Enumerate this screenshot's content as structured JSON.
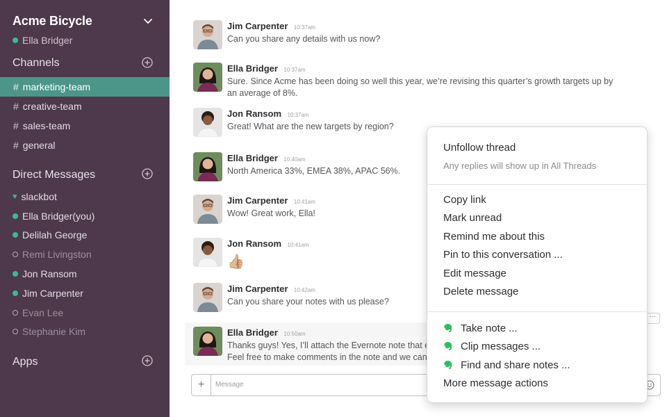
{
  "colors": {
    "sidebar_bg": "#4d394b",
    "active_channel": "#4c9689",
    "presence_online": "#3eb991",
    "evernote_green": "#2dbe60"
  },
  "team": {
    "name": "Acme Bicycle",
    "user": "Ella Bridger"
  },
  "sections": {
    "channels_title": "Channels",
    "direct_messages_title": "Direct Messages",
    "apps_title": "Apps"
  },
  "channels": [
    {
      "name": "marketing-team",
      "active": true
    },
    {
      "name": "creative-team",
      "active": false
    },
    {
      "name": "sales-team",
      "active": false
    },
    {
      "name": "general",
      "active": false
    }
  ],
  "direct_messages": [
    {
      "name": "slackbot",
      "status": "bot"
    },
    {
      "name": "Ella Bridger(you)",
      "status": "online"
    },
    {
      "name": "Delilah George",
      "status": "online"
    },
    {
      "name": "Remi Livingston",
      "status": "away"
    },
    {
      "name": "Jon Ransom",
      "status": "online"
    },
    {
      "name": "Jim Carpenter",
      "status": "online"
    },
    {
      "name": "Evan Lee",
      "status": "away"
    },
    {
      "name": "Stephanie Kim",
      "status": "away"
    }
  ],
  "messages": [
    {
      "author": "Jim Carpenter",
      "time": "10:37am",
      "text": "Can you share any details with us now?"
    },
    {
      "author": "Ella Bridger",
      "time": "10:37am",
      "text": "Sure. Since Acme has been doing so well this year, we’re revising this quarter’s growth targets up by an average of 8%."
    },
    {
      "author": "Jon Ransom",
      "time": "10:37am",
      "text": "Great! What are the new targets by region?"
    },
    {
      "author": "Ella Bridger",
      "time": "10:40am",
      "text": "North America 33%, EMEA 38%, APAC 56%."
    },
    {
      "author": "Jim Carpenter",
      "time": "10:41am",
      "text": "Wow! Great work, Ella!"
    },
    {
      "author": "Jon Ransom",
      "time": "10:41am",
      "text": "👍🏼"
    },
    {
      "author": "Jim Carpenter",
      "time": "10:42am",
      "text": "Can you share your notes with us please?"
    },
    {
      "author": "Ella Bridger",
      "time": "10:50am",
      "text": "Thanks guys! Yes, I’ll attach the Evernote note that ex",
      "text2": "Feel free to make comments in the note and we can"
    }
  ],
  "composer": {
    "placeholder": "Message"
  },
  "more_actions": "···",
  "menu": {
    "unfollow": "Unfollow thread",
    "unfollow_sub": "Any replies will show up in All Threads",
    "copy_link": "Copy link",
    "mark_unread": "Mark unread",
    "remind": "Remind me about this",
    "pin": "Pin to this conversation ...",
    "edit": "Edit message",
    "delete": "Delete message",
    "take_note": "Take note ...",
    "clip": "Clip messages ...",
    "find_share": "Find and share notes ...",
    "more_actions": "More message actions"
  }
}
